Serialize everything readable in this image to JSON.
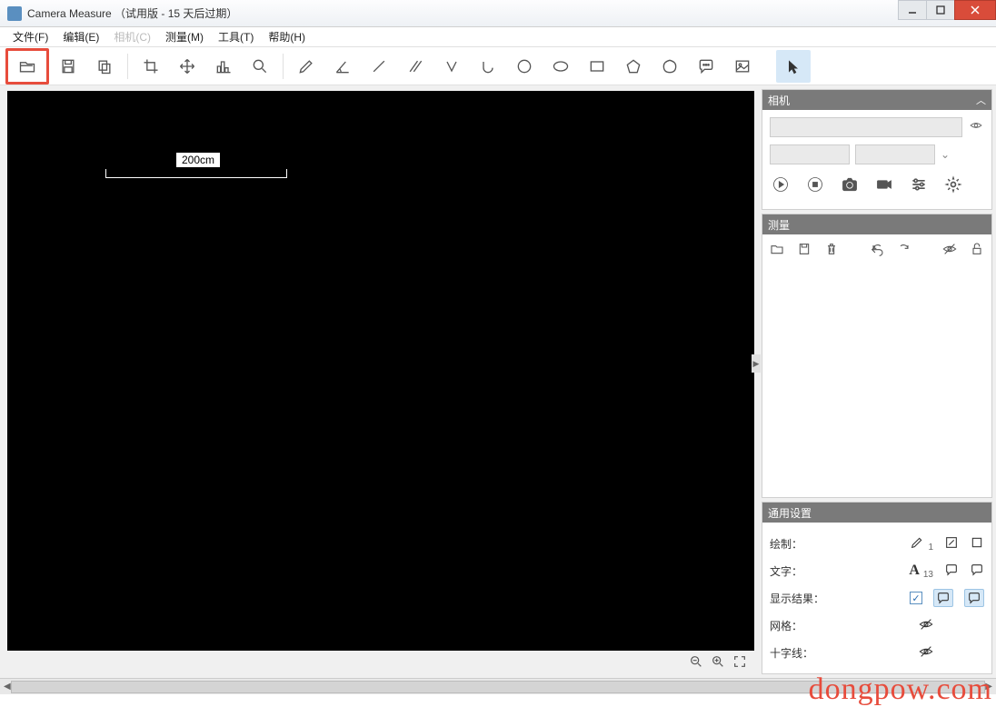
{
  "title": "Camera Measure （试用版 - 15 天后过期）",
  "menu": {
    "file": "文件(F)",
    "edit": "编辑(E)",
    "camera": "相机(C)",
    "measure": "测量(M)",
    "tool": "工具(T)",
    "help": "帮助(H)"
  },
  "canvas": {
    "scale_label": "200cm"
  },
  "panels": {
    "camera": {
      "title": "相机"
    },
    "measure": {
      "title": "测量"
    },
    "settings": {
      "title": "通用设置",
      "draw": "绘制：",
      "draw_size": "1",
      "text": "文字：",
      "text_size": "13",
      "show_result": "显示结果：",
      "grid": "网格：",
      "crosshair": "十字线："
    }
  },
  "watermark": "dongpow.com"
}
